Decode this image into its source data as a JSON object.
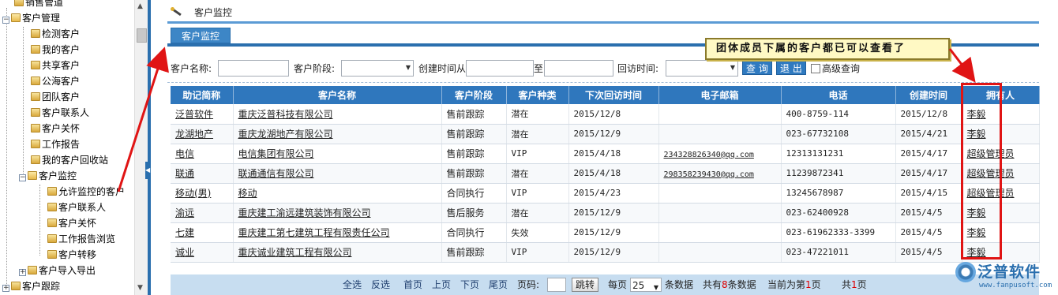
{
  "tree": {
    "items": [
      {
        "label": "销售管道",
        "kind": "leaf"
      },
      {
        "label": "客户管理",
        "kind": "folder"
      },
      {
        "label": "检测客户",
        "kind": "leaf"
      },
      {
        "label": "我的客户",
        "kind": "leaf"
      },
      {
        "label": "共享客户",
        "kind": "leaf"
      },
      {
        "label": "公海客户",
        "kind": "leaf"
      },
      {
        "label": "团队客户",
        "kind": "leaf"
      },
      {
        "label": "客户联系人",
        "kind": "leaf"
      },
      {
        "label": "客户关怀",
        "kind": "leaf"
      },
      {
        "label": "工作报告",
        "kind": "leaf"
      },
      {
        "label": "我的客户回收站",
        "kind": "leaf"
      },
      {
        "label": "客户监控",
        "kind": "folder"
      },
      {
        "label": "允许监控的客户",
        "kind": "leaf"
      },
      {
        "label": "客户联系人",
        "kind": "leaf"
      },
      {
        "label": "客户关怀",
        "kind": "leaf"
      },
      {
        "label": "工作报告浏览",
        "kind": "leaf"
      },
      {
        "label": "客户转移",
        "kind": "leaf"
      },
      {
        "label": "客户导入导出",
        "kind": "folder-closed"
      },
      {
        "label": "客户跟踪",
        "kind": "folder-closed"
      }
    ]
  },
  "header": {
    "breadcrumb": "客户监控",
    "tab": "客户监控"
  },
  "search": {
    "name_label": "客户名称:",
    "stage_label": "客户阶段:",
    "created_from_label": "创建时间从",
    "to_label": "至",
    "visit_label": "回访时间:",
    "query_button": "查 询",
    "exit_button": "退 出",
    "advanced_label": "高级查询"
  },
  "callout": "团体成员下属的客户都已可以查看了",
  "table": {
    "columns": [
      "助记简称",
      "客户名称",
      "客户阶段",
      "客户种类",
      "下次回访时间",
      "电子邮箱",
      "电话",
      "创建时间",
      "拥有人"
    ],
    "rows": [
      [
        "泛普软件",
        "重庆泛普科技有限公司",
        "售前跟踪",
        "潜在",
        "2015/12/8",
        "",
        "400-8759-114",
        "2015/12/8",
        "李毅"
      ],
      [
        "龙湖地产",
        "重庆龙湖地产有限公司",
        "售前跟踪",
        "潜在",
        "2015/12/9",
        "",
        "023-67732108",
        "2015/4/21",
        "李毅"
      ],
      [
        "电信",
        "电信集团有限公司",
        "售前跟踪",
        "VIP",
        "2015/4/18",
        "234328826340@qq.com",
        "12313131231",
        "2015/4/17",
        "超级管理员"
      ],
      [
        "联通",
        "联通通信有限公司",
        "售前跟踪",
        "潜在",
        "2015/4/18",
        "298358239430@qq.com",
        "11239872341",
        "2015/4/17",
        "超级管理员"
      ],
      [
        "移动(男)",
        "移动",
        "合同执行",
        "VIP",
        "2015/4/23",
        "",
        "13245678987",
        "2015/4/15",
        "超级管理员"
      ],
      [
        "渝远",
        "重庆建工渝远建筑装饰有限公司",
        "售后服务",
        "潜在",
        "2015/12/9",
        "",
        "023-62400928",
        "2015/4/5",
        "李毅"
      ],
      [
        "七建",
        "重庆建工第七建筑工程有限责任公司",
        "合同执行",
        "失效",
        "2015/12/9",
        "",
        "023-61962333-3399",
        "2015/4/5",
        "李毅"
      ],
      [
        "诚业",
        "重庆诚业建筑工程有限公司",
        "售前跟踪",
        "VIP",
        "2015/12/9",
        "",
        "023-47221011",
        "2015/4/5",
        "李毅"
      ]
    ]
  },
  "pager": {
    "select_all": "全选",
    "invert": "反选",
    "first": "首页",
    "prev": "上页",
    "next": "下页",
    "last": "尾页",
    "page_label": "页码:",
    "jump": "跳转",
    "per_page": "每页",
    "per_page_value": "25",
    "per_page_suffix": "条数据",
    "total_prefix": "共有",
    "total_count": "8",
    "total_suffix": "条数据",
    "current_prefix": "当前为第",
    "current_page": "1",
    "current_suffix": "页",
    "pages_prefix": "共",
    "pages_count": "1",
    "pages_suffix": "页"
  },
  "logo": {
    "name": "泛普软件",
    "url": "www.fanpusoft.com"
  },
  "colors": {
    "header_blue": "#2f77bd",
    "annotation_red": "#e01414",
    "callout_bg": "#fff9c4"
  }
}
